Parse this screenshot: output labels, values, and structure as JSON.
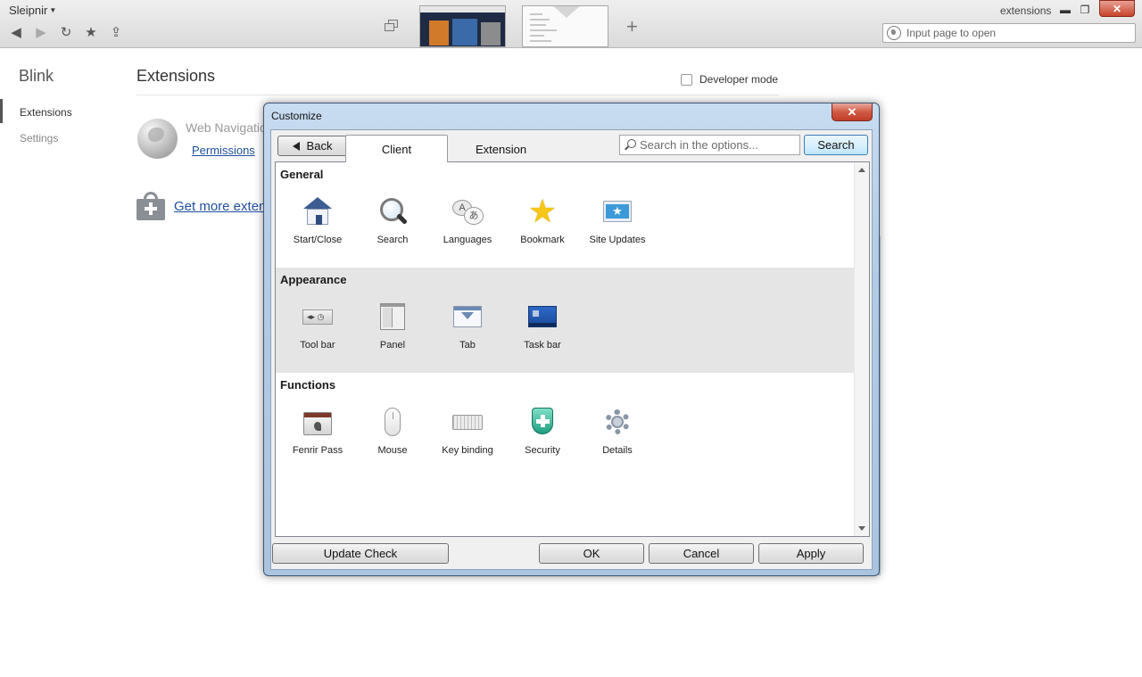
{
  "browser": {
    "app_name": "Sleipnir",
    "window_title": "extensions",
    "address_placeholder": "Input page to open",
    "new_tab_label": "+"
  },
  "page": {
    "brand": "Blink",
    "sidebar": [
      {
        "label": "Extensions"
      },
      {
        "label": "Settings"
      }
    ],
    "title": "Extensions",
    "developer_mode_label": "Developer mode",
    "extension": {
      "name": "Web Navigatio",
      "permissions_link": "Permissions"
    },
    "get_more_link": "Get more exten"
  },
  "dialog": {
    "title": "Customize",
    "close_label": "✕",
    "back_label": "Back",
    "tabs": [
      {
        "label": "Client"
      },
      {
        "label": "Extension"
      }
    ],
    "search_placeholder": "Search in the options...",
    "search_button": "Search",
    "sections": [
      {
        "title": "General",
        "items": [
          {
            "label": "Start/Close",
            "icon": "house-icon"
          },
          {
            "label": "Search",
            "icon": "magnifier-icon"
          },
          {
            "label": "Languages",
            "icon": "speech-bubbles-icon"
          },
          {
            "label": "Bookmark",
            "icon": "star-icon"
          },
          {
            "label": "Site Updates",
            "icon": "site-update-icon"
          }
        ]
      },
      {
        "title": "Appearance",
        "items": [
          {
            "label": "Tool bar",
            "icon": "toolbar-icon"
          },
          {
            "label": "Panel",
            "icon": "panel-icon"
          },
          {
            "label": "Tab",
            "icon": "tab-icon"
          },
          {
            "label": "Task bar",
            "icon": "taskbar-icon"
          }
        ]
      },
      {
        "title": "Functions",
        "items": [
          {
            "label": "Fenrir Pass",
            "icon": "fenrir-pass-icon"
          },
          {
            "label": "Mouse",
            "icon": "mouse-icon"
          },
          {
            "label": "Key binding",
            "icon": "keyboard-icon"
          },
          {
            "label": "Security",
            "icon": "shield-icon"
          },
          {
            "label": "Details",
            "icon": "gear-icon"
          }
        ]
      }
    ],
    "footer": {
      "update_check": "Update Check",
      "ok": "OK",
      "cancel": "Cancel",
      "apply": "Apply"
    }
  }
}
